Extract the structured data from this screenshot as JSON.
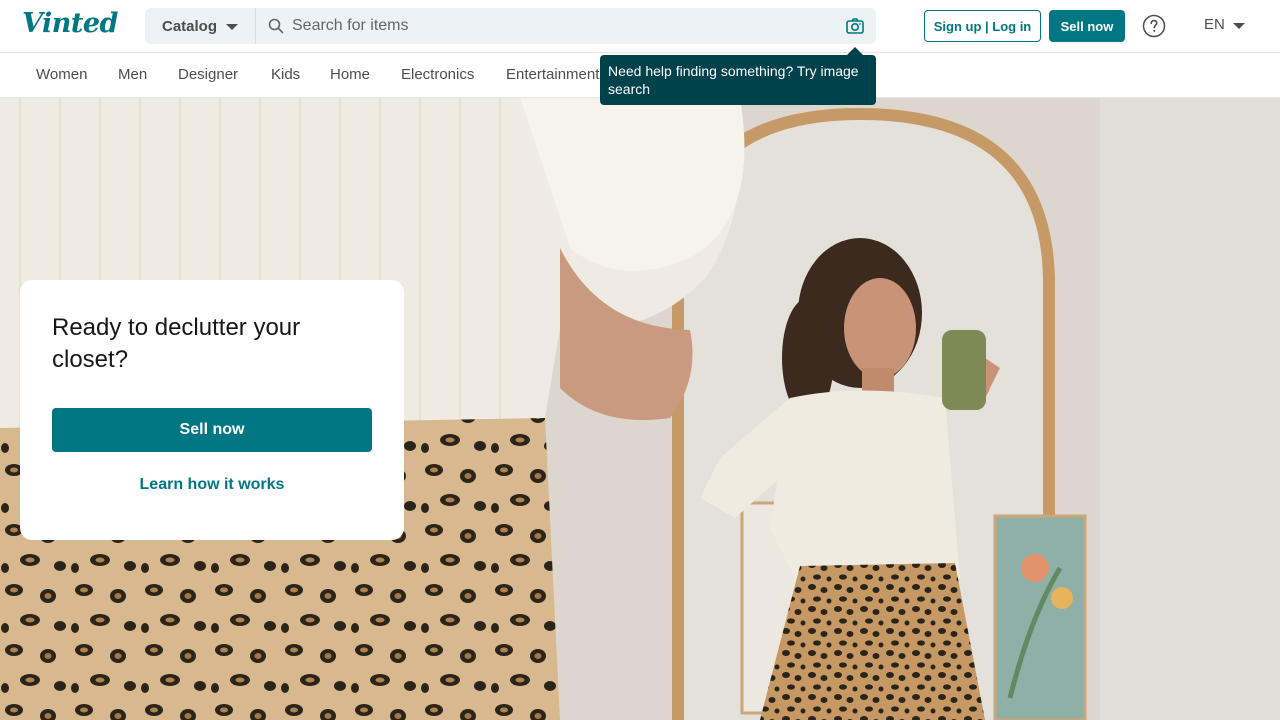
{
  "brand": {
    "logo_text": "Vinted",
    "accent_color": "#007782",
    "tooltip_color": "#00424b"
  },
  "header": {
    "catalog_label": "Catalog",
    "search": {
      "placeholder": "Search for items",
      "value": ""
    },
    "icons": [
      "search-icon",
      "camera-icon",
      "help-icon",
      "chevron-down-icon"
    ],
    "signup_login_label": "Sign up | Log in",
    "sell_now_label": "Sell now",
    "language_label": "EN"
  },
  "tooltip": {
    "text": "Need help finding something? Try image search"
  },
  "categories": [
    {
      "label": "Women"
    },
    {
      "label": "Men"
    },
    {
      "label": "Designer"
    },
    {
      "label": "Kids"
    },
    {
      "label": "Home"
    },
    {
      "label": "Electronics"
    },
    {
      "label": "Entertainment"
    }
  ],
  "hero": {
    "card": {
      "title": "Ready to declutter your closet?",
      "button_label": "Sell now",
      "link_label": "Learn how it works"
    }
  }
}
